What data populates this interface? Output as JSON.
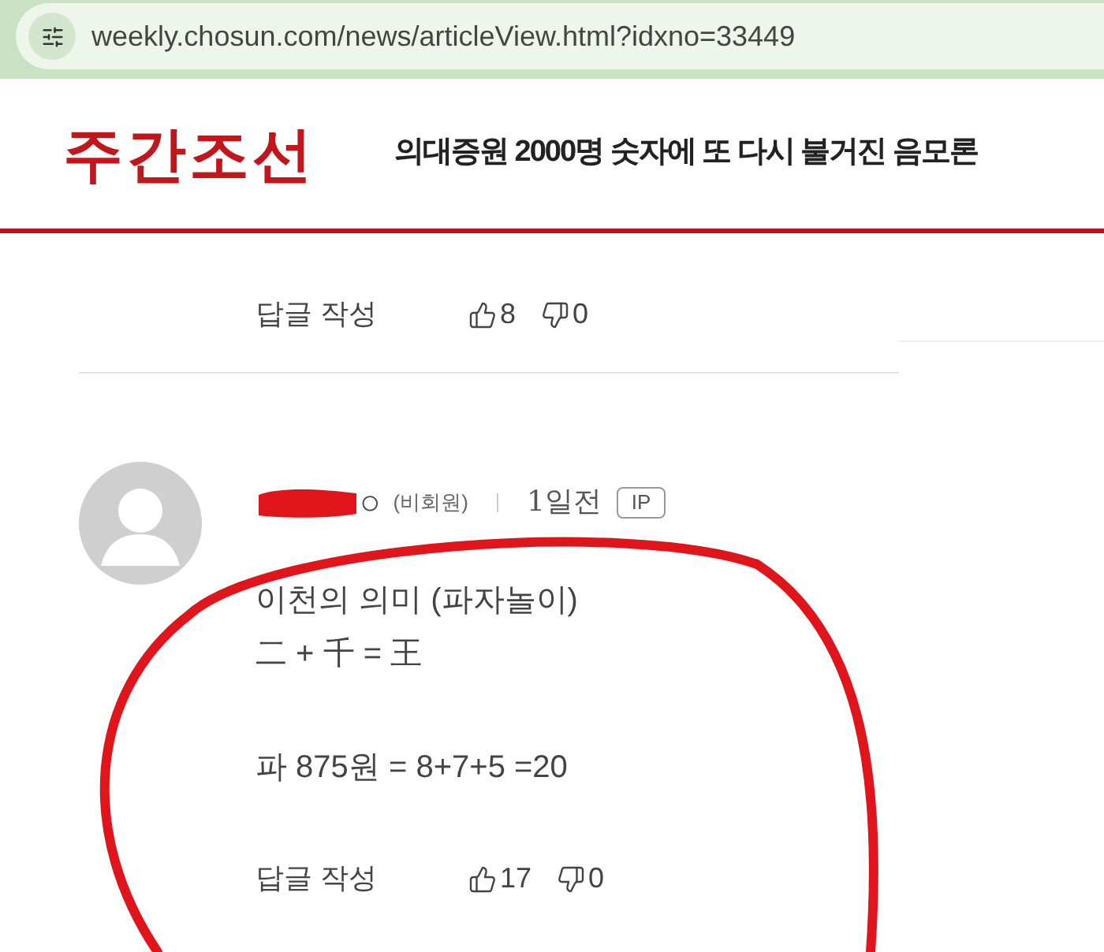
{
  "address_bar": {
    "url": "weekly.chosun.com/news/articleView.html?idxno=33449"
  },
  "header": {
    "logo": "주간조선",
    "headline": "의대증원 2000명 숫자에 또 다시 불거진 음모론"
  },
  "previous_comment": {
    "reply_label": "답글 작성",
    "likes": "8",
    "dislikes": "0"
  },
  "comment": {
    "author": "○",
    "member_status": "(비회원)",
    "time": "1일전",
    "badge": "IP",
    "body": [
      [
        "이천의 의미 (파자놀이)",
        "二 + 千 = 王"
      ],
      [
        "파 875원 = 8+7+5 =20"
      ]
    ],
    "reply_label": "답글 작성",
    "likes": "17",
    "dislikes": "0"
  }
}
